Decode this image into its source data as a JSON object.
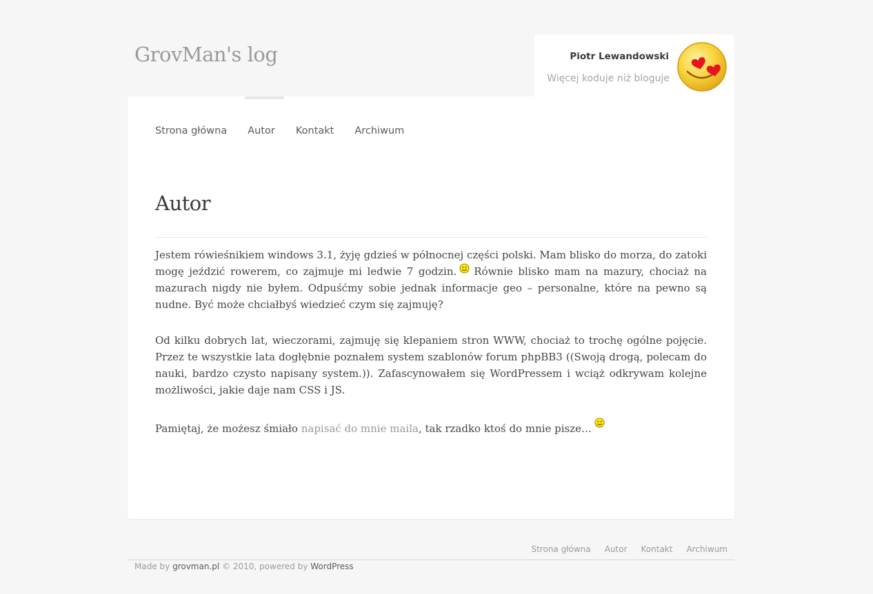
{
  "site": {
    "title": "GrovMan's log"
  },
  "author": {
    "name": "Piotr Lewandowski",
    "tagline": "Więcej koduje niż bloguje",
    "avatar_icon": "heart-eyes-smiley-icon"
  },
  "nav": {
    "items": [
      "Strona główna",
      "Autor",
      "Kontakt",
      "Archiwum"
    ],
    "active": "Autor"
  },
  "page": {
    "title": "Autor",
    "p1_a": "Jestem rówieśnikiem windows 3.1, żyję gdzieś w północnej części polski. Mam blisko do morza, do zatoki mogę jeździć rowerem, co zajmuje mi ledwie 7 godzin.",
    "p1_b": "Równie blisko mam na mazury, chociaż na mazurach nigdy nie byłem. Odpuśćmy sobie jednak informacje geo – personalne, które na pewno są nudne. Być może chciałbyś wiedzieć czym się zajmuję?",
    "p2": "Od kilku dobrych lat, wieczorami, zajmuję się klepaniem stron WWW, chociaż to trochę ogólne pojęcie. Przez te wszystkie lata dogłębnie poznałem system szablonów forum phpBB3 ((Swoją drogą, polecam do nauki, bardzo czysto napisany system.)). Zafascynowałem się WordPressem i wciąż odkrywam kolejne możliwości, jakie daje nam CSS i JS.",
    "p3_a": "Pamiętaj, że możesz śmiało",
    "p3_link": "napisać do mnie maila",
    "p3_b": ", tak rzadko ktoś do mnie pisze…",
    "smiley_icon": "smiley-icon"
  },
  "footer": {
    "nav": [
      "Strona główna",
      "Autor",
      "Kontakt",
      "Archiwum"
    ],
    "made_by": "Made by",
    "site_link": "grovman.pl",
    "middle": "© 2010, powered by",
    "wp_link": "WordPress"
  },
  "colors": {
    "background": "#f6f6f6",
    "card": "#ffffff",
    "link_muted": "#999999",
    "text": "#444444"
  }
}
